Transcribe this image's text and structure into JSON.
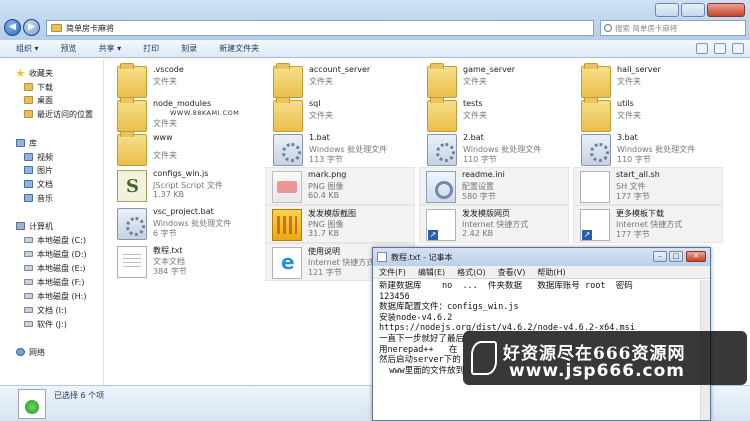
{
  "window": {
    "address_path": "简单房卡麻将",
    "search_placeholder": "搜索 简单房卡麻将"
  },
  "toolbar": {
    "items": [
      "组织 ▾",
      "预览",
      "共享 ▾",
      "打印",
      "刻录",
      "新建文件夹"
    ]
  },
  "sidebar": {
    "items": [
      {
        "label": "收藏夹",
        "icon": "star-icon"
      },
      {
        "label": "下载",
        "icon": "folder-icon"
      },
      {
        "label": "桌面",
        "icon": "folder-icon"
      },
      {
        "label": "最近访问的位置",
        "icon": "folder-icon"
      },
      {
        "label": "库",
        "icon": "library-icon"
      },
      {
        "label": "视频",
        "icon": "library-icon"
      },
      {
        "label": "图片",
        "icon": "library-icon"
      },
      {
        "label": "文档",
        "icon": "library-icon"
      },
      {
        "label": "音乐",
        "icon": "library-icon"
      },
      {
        "label": "计算机",
        "icon": "computer-icon"
      },
      {
        "label": "本地磁盘 (C:)",
        "icon": "drive-icon"
      },
      {
        "label": "本地磁盘 (D:)",
        "icon": "drive-icon"
      },
      {
        "label": "本地磁盘 (E:)",
        "icon": "drive-icon"
      },
      {
        "label": "本地磁盘 (F:)",
        "icon": "drive-icon"
      },
      {
        "label": "本地磁盘 (H:)",
        "icon": "drive-icon"
      },
      {
        "label": "文档 (I:)",
        "icon": "drive-icon"
      },
      {
        "label": "软件 (J:)",
        "icon": "drive-icon"
      },
      {
        "label": "网络",
        "icon": "network-icon"
      }
    ]
  },
  "files": [
    {
      "name": ".vscode",
      "type": "文件夹",
      "size": "",
      "icon": "folder-icon"
    },
    {
      "name": "account_server",
      "type": "文件夹",
      "size": "",
      "icon": "folder-icon"
    },
    {
      "name": "game_server",
      "type": "文件夹",
      "size": "",
      "icon": "folder-icon"
    },
    {
      "name": "hall_server",
      "type": "文件夹",
      "size": "",
      "icon": "folder-icon"
    },
    {
      "name": "node_modules",
      "type": "文件夹",
      "size": "",
      "icon": "folder-icon"
    },
    {
      "name": "sql",
      "type": "文件夹",
      "size": "",
      "icon": "folder-icon"
    },
    {
      "name": "tests",
      "type": "文件夹",
      "size": "",
      "icon": "folder-icon"
    },
    {
      "name": "utils",
      "type": "文件夹",
      "size": "",
      "icon": "folder-icon"
    },
    {
      "name": "www",
      "type": "文件夹",
      "size": "",
      "icon": "folder-icon"
    },
    {
      "name": "1.bat",
      "type": "Windows 批处理文件",
      "size": "113 字节",
      "icon": "batch-file-icon"
    },
    {
      "name": "2.bat",
      "type": "Windows 批处理文件",
      "size": "110 字节",
      "icon": "batch-file-icon"
    },
    {
      "name": "3.bat",
      "type": "Windows 批处理文件",
      "size": "110 字节",
      "icon": "batch-file-icon"
    },
    {
      "name": "configs_win.js",
      "type": "JScript Script 文件",
      "size": "1.37 KB",
      "icon": "script-file-icon"
    },
    {
      "name": "mark.png",
      "type": "PNG 图像",
      "size": "60.4 KB",
      "icon": "image-file-icon"
    },
    {
      "name": "readme.ini",
      "type": "配置设置",
      "size": "580 字节",
      "icon": "ini-file-icon"
    },
    {
      "name": "start_all.sh",
      "type": "SH 文件",
      "size": "177 字节",
      "icon": "sh-file-icon"
    },
    {
      "name": "vsc_project.bat",
      "type": "Windows 批处理文件",
      "size": "6 字节",
      "icon": "batch-file-icon"
    },
    {
      "name": "发发模版截图",
      "type": "PNG 图像",
      "size": "31.7 KB",
      "icon": "image-thumb-icon"
    },
    {
      "name": "发发模版网页",
      "type": "Internet 快捷方式",
      "size": "2.42 KB",
      "icon": "shortcut-icon"
    },
    {
      "name": "更多模板下载",
      "type": "Internet 快捷方式",
      "size": "177 字节",
      "icon": "shortcut-icon"
    },
    {
      "name": "教程.txt",
      "type": "文本文档",
      "size": "384 字节",
      "icon": "text-file-icon"
    },
    {
      "name": "使用说明",
      "type": "Internet 快捷方式",
      "size": "121 字节",
      "icon": "internet-shortcut-icon"
    }
  ],
  "small_watermark": "WWW.88KAMI.COM",
  "details": {
    "status": "已选择 6 个项"
  },
  "notepad": {
    "title": "教程.txt - 记事本",
    "menu": [
      "文件(F)",
      "编辑(E)",
      "格式(O)",
      "查看(V)",
      "帮助(H)"
    ],
    "lines": [
      "新建数据库    no  ...  件夹数据   数据库账号 root  密码",
      "123456",
      "数据库配置文件：configs_win.js",
      "安装node-v4.6.2",
      "https://nodejs.org/dist/v4.6.2/node-v4.6.2-x64.msi",
      "一直下一步就好了最后",
      "用nerepad++   在",
      "然后启动server下的",
      "  www里面的文件放到"
    ]
  },
  "stamp": {
    "line1": "好资源尽在666资源网",
    "line2": "www.jsp666.com"
  }
}
